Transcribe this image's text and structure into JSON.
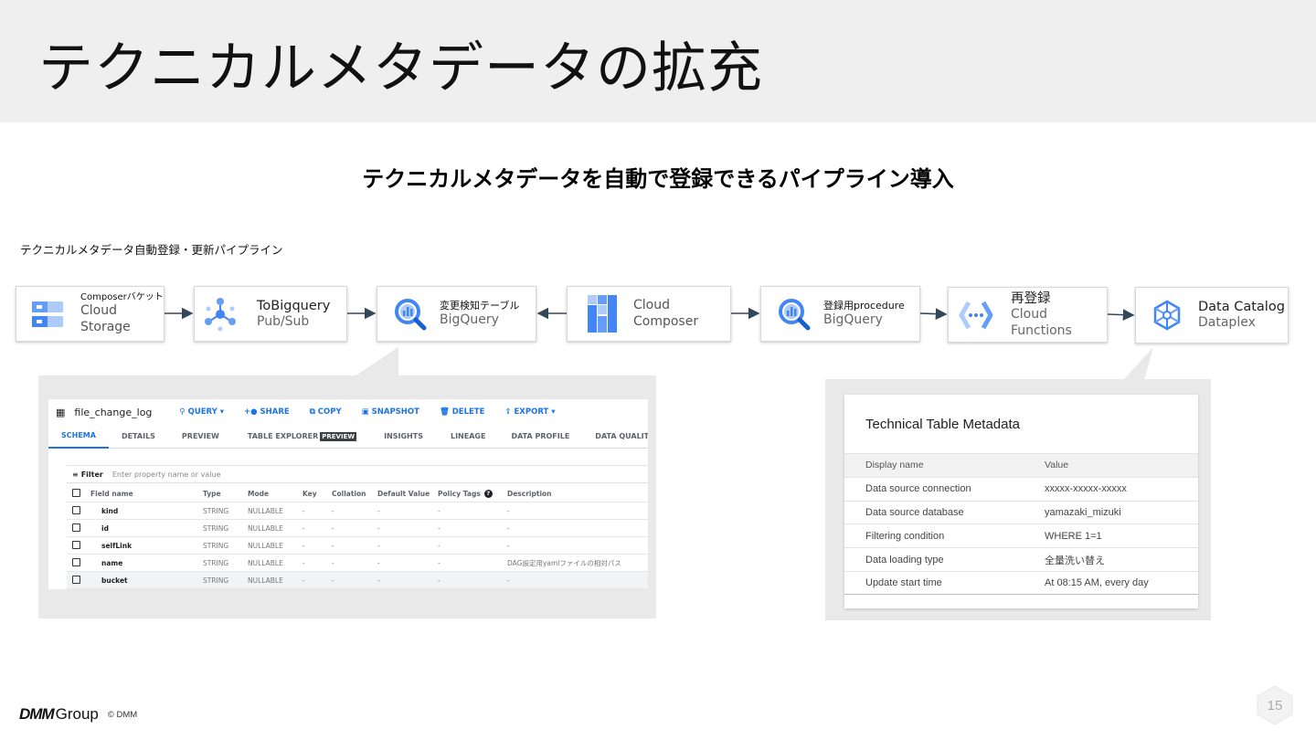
{
  "slide": {
    "title": "テクニカルメタデータの拡充",
    "subtitle": "テクニカルメタデータを自動で登録できるパイプライン導入",
    "pipeline_caption": "テクニカルメタデータ自動登録・更新パイプライン",
    "page_number": "15"
  },
  "pipeline": {
    "node1": {
      "small": "Composerバケット",
      "main1": "Cloud",
      "main2": "Storage",
      "icon": "cloud-storage-icon"
    },
    "node2": {
      "main": "ToBigquery",
      "sub": "Pub/Sub",
      "icon": "pubsub-icon"
    },
    "node3": {
      "small": "変更検知テーブル",
      "sub": "BigQuery",
      "icon": "bigquery-icon"
    },
    "node4": {
      "main": "Cloud Composer",
      "icon": "cloud-composer-icon"
    },
    "node5": {
      "small": "登録用procedure",
      "sub": "BigQuery",
      "icon": "bigquery-icon"
    },
    "node6": {
      "main": "再登録",
      "sub": "Cloud Functions",
      "icon": "cloud-functions-icon"
    },
    "node7": {
      "main": "Data Catalog",
      "sub": "Dataplex",
      "icon": "dataplex-icon"
    }
  },
  "bigquery_schema": {
    "table_name": "file_change_log",
    "actions": [
      "QUERY",
      "SHARE",
      "COPY",
      "SNAPSHOT",
      "DELETE",
      "EXPORT"
    ],
    "tabs": [
      "SCHEMA",
      "DETAILS",
      "PREVIEW",
      "TABLE EXPLORER",
      "INSIGHTS",
      "LINEAGE",
      "DATA PROFILE",
      "DATA QUALITY"
    ],
    "preview_badge": "PREVIEW",
    "filter_label": "Filter",
    "filter_placeholder": "Enter property name or value",
    "columns": [
      "Field name",
      "Type",
      "Mode",
      "Key",
      "Collation",
      "Default Value",
      "Policy Tags",
      "Description"
    ],
    "rows": [
      {
        "name": "kind",
        "type": "STRING",
        "mode": "NULLABLE",
        "key": "-",
        "collation": "-",
        "default": "-",
        "policy": "-",
        "desc": "-"
      },
      {
        "name": "id",
        "type": "STRING",
        "mode": "NULLABLE",
        "key": "-",
        "collation": "-",
        "default": "-",
        "policy": "-",
        "desc": "-"
      },
      {
        "name": "selfLink",
        "type": "STRING",
        "mode": "NULLABLE",
        "key": "-",
        "collation": "-",
        "default": "-",
        "policy": "-",
        "desc": "-"
      },
      {
        "name": "name",
        "type": "STRING",
        "mode": "NULLABLE",
        "key": "-",
        "collation": "-",
        "default": "-",
        "policy": "-",
        "desc": "DAG設定用yamlファイルの相対パス"
      },
      {
        "name": "bucket",
        "type": "STRING",
        "mode": "NULLABLE",
        "key": "-",
        "collation": "-",
        "default": "-",
        "policy": "-",
        "desc": "-"
      }
    ]
  },
  "technical_metadata": {
    "title": "Technical Table Metadata",
    "header": {
      "key": "Display name",
      "value": "Value"
    },
    "rows": [
      {
        "key": "Data source connection",
        "value": "xxxxx-xxxxx-xxxxx"
      },
      {
        "key": "Data source database",
        "value": "yamazaki_mizuki"
      },
      {
        "key": "Filtering condition",
        "value": "WHERE 1=1"
      },
      {
        "key": "Data loading type",
        "value": "全量洗い替え"
      },
      {
        "key": "Update start time",
        "value": "At 08:15 AM, every day"
      }
    ]
  },
  "footer": {
    "brand": "DMM",
    "brand2": "Group",
    "copyright": "© DMM"
  },
  "colors": {
    "header_bg": "#efefef",
    "gcp_blue": "#4285f4",
    "gcp_light_blue": "#aecbfa",
    "link_blue": "#1a73e8",
    "arrow": "#33475b"
  }
}
